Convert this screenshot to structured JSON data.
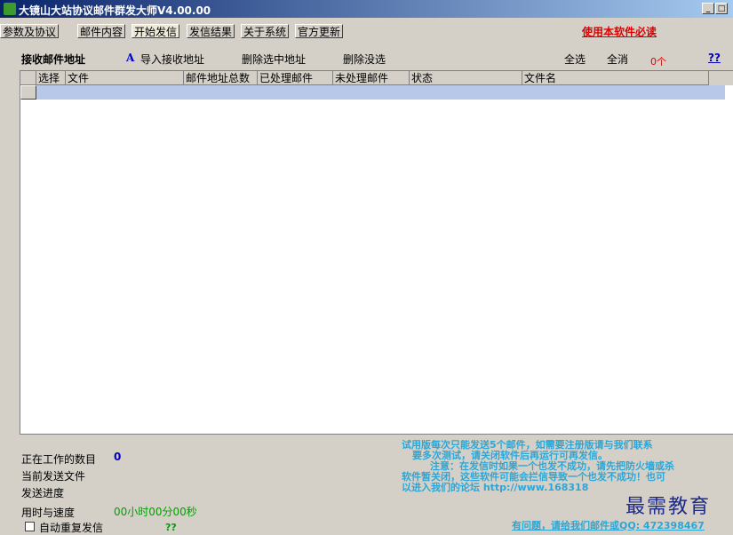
{
  "window": {
    "title": "大镜山大站协议邮件群发大师V4.00.00",
    "minimize_glyph": "_",
    "maximize_glyph": "□"
  },
  "tabs": [
    {
      "label": "参数及协议"
    },
    {
      "label": "邮件内容"
    },
    {
      "label": "开始发信",
      "active": true
    },
    {
      "label": "发信结果"
    },
    {
      "label": "关于系统"
    },
    {
      "label": "官方更新"
    }
  ],
  "must_read_link": "使用本软件必读",
  "toolbar": {
    "heading": "接收邮件地址",
    "import_icon_glyph": "A",
    "import_label": "导入接收地址",
    "delete_selected": "删除选中地址",
    "delete_unselected": "删除没选",
    "select_all": "全选",
    "deselect_all": "全消",
    "count": "0个",
    "help": "??"
  },
  "grid": {
    "columns": [
      "选择",
      "文件",
      "邮件地址总数",
      "已处理邮件",
      "未处理邮件",
      "状态",
      "文件名"
    ]
  },
  "status": {
    "working_label": "正在工作的数目",
    "working_value": "0",
    "current_file_label": "当前发送文件",
    "progress_label": "发送进度",
    "time_speed_label": "用时与速度",
    "time_value": "00小时00分00秒",
    "auto_resend_label": "自动重复发信",
    "auto_resend_help": "??"
  },
  "notice_lines": [
    "试用版每次只能发送5个邮件，如需要注册版请与我们联系",
    "要多次测试，请关闭软件后再运行可再发信。",
    "注意：在发信时如果一个也发不成功，请先把防火墙或杀",
    "软件暂关闭，这些软件可能会拦信导致一个也发不成功！也可",
    "以进入我们的论坛 http://www.168318"
  ],
  "watermark": "最需教育",
  "contact_text": "有问题，请给我们邮件或QQ: 472398467"
}
